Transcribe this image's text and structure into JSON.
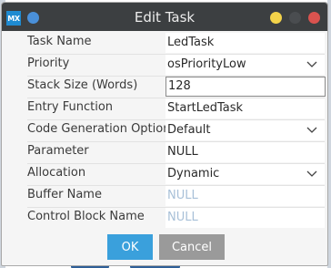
{
  "window": {
    "title": "Edit Task",
    "app_badge": "MX",
    "controls": {
      "left_dot_color": "#4a90d9",
      "minimize_color": "#f3d34a",
      "maximize_color": "#4a4d50",
      "close_color": "#d9534f"
    }
  },
  "form": {
    "rows": [
      {
        "label": "Task Name",
        "value": "LedTask",
        "type": "text"
      },
      {
        "label": "Priority",
        "value": "osPriorityLow",
        "type": "select"
      },
      {
        "label": "Stack Size (Words)",
        "value": "128",
        "type": "text",
        "focused": true
      },
      {
        "label": "Entry Function",
        "value": "StartLedTask",
        "type": "text"
      },
      {
        "label": "Code Generation Option",
        "value": "Default",
        "type": "select"
      },
      {
        "label": "Parameter",
        "value": "NULL",
        "type": "text"
      },
      {
        "label": "Allocation",
        "value": "Dynamic",
        "type": "select"
      },
      {
        "label": "Buffer Name",
        "value": "NULL",
        "type": "text",
        "placeholder": true
      },
      {
        "label": "Control Block Name",
        "value": "NULL",
        "type": "text",
        "placeholder": true
      }
    ]
  },
  "buttons": {
    "ok_label": "OK",
    "cancel_label": "Cancel"
  },
  "colors": {
    "accent": "#3aa0dc",
    "secondary_button": "#9a9a9a",
    "titlebar": "#3c3f41"
  }
}
